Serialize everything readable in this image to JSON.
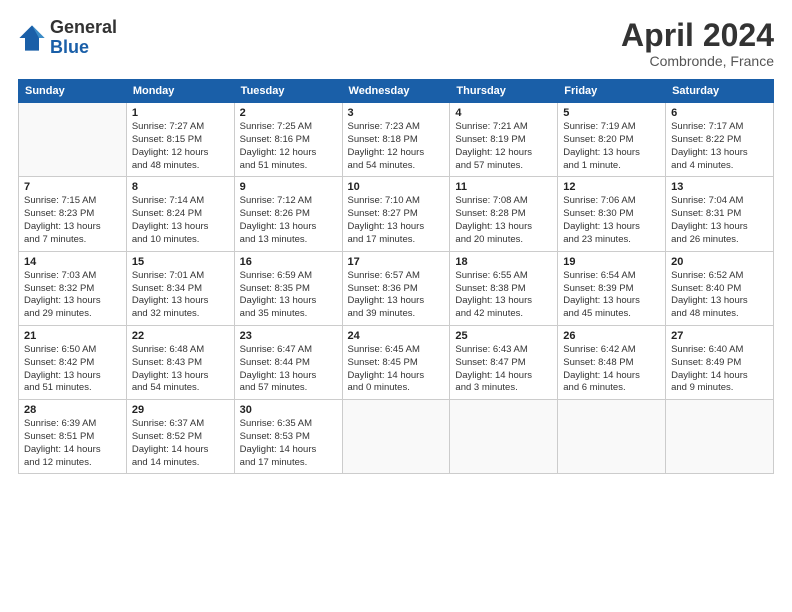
{
  "logo": {
    "general": "General",
    "blue": "Blue"
  },
  "title": "April 2024",
  "location": "Combronde, France",
  "days_header": [
    "Sunday",
    "Monday",
    "Tuesday",
    "Wednesday",
    "Thursday",
    "Friday",
    "Saturday"
  ],
  "weeks": [
    [
      {
        "num": "",
        "info": ""
      },
      {
        "num": "1",
        "info": "Sunrise: 7:27 AM\nSunset: 8:15 PM\nDaylight: 12 hours\nand 48 minutes."
      },
      {
        "num": "2",
        "info": "Sunrise: 7:25 AM\nSunset: 8:16 PM\nDaylight: 12 hours\nand 51 minutes."
      },
      {
        "num": "3",
        "info": "Sunrise: 7:23 AM\nSunset: 8:18 PM\nDaylight: 12 hours\nand 54 minutes."
      },
      {
        "num": "4",
        "info": "Sunrise: 7:21 AM\nSunset: 8:19 PM\nDaylight: 12 hours\nand 57 minutes."
      },
      {
        "num": "5",
        "info": "Sunrise: 7:19 AM\nSunset: 8:20 PM\nDaylight: 13 hours\nand 1 minute."
      },
      {
        "num": "6",
        "info": "Sunrise: 7:17 AM\nSunset: 8:22 PM\nDaylight: 13 hours\nand 4 minutes."
      }
    ],
    [
      {
        "num": "7",
        "info": "Sunrise: 7:15 AM\nSunset: 8:23 PM\nDaylight: 13 hours\nand 7 minutes."
      },
      {
        "num": "8",
        "info": "Sunrise: 7:14 AM\nSunset: 8:24 PM\nDaylight: 13 hours\nand 10 minutes."
      },
      {
        "num": "9",
        "info": "Sunrise: 7:12 AM\nSunset: 8:26 PM\nDaylight: 13 hours\nand 13 minutes."
      },
      {
        "num": "10",
        "info": "Sunrise: 7:10 AM\nSunset: 8:27 PM\nDaylight: 13 hours\nand 17 minutes."
      },
      {
        "num": "11",
        "info": "Sunrise: 7:08 AM\nSunset: 8:28 PM\nDaylight: 13 hours\nand 20 minutes."
      },
      {
        "num": "12",
        "info": "Sunrise: 7:06 AM\nSunset: 8:30 PM\nDaylight: 13 hours\nand 23 minutes."
      },
      {
        "num": "13",
        "info": "Sunrise: 7:04 AM\nSunset: 8:31 PM\nDaylight: 13 hours\nand 26 minutes."
      }
    ],
    [
      {
        "num": "14",
        "info": "Sunrise: 7:03 AM\nSunset: 8:32 PM\nDaylight: 13 hours\nand 29 minutes."
      },
      {
        "num": "15",
        "info": "Sunrise: 7:01 AM\nSunset: 8:34 PM\nDaylight: 13 hours\nand 32 minutes."
      },
      {
        "num": "16",
        "info": "Sunrise: 6:59 AM\nSunset: 8:35 PM\nDaylight: 13 hours\nand 35 minutes."
      },
      {
        "num": "17",
        "info": "Sunrise: 6:57 AM\nSunset: 8:36 PM\nDaylight: 13 hours\nand 39 minutes."
      },
      {
        "num": "18",
        "info": "Sunrise: 6:55 AM\nSunset: 8:38 PM\nDaylight: 13 hours\nand 42 minutes."
      },
      {
        "num": "19",
        "info": "Sunrise: 6:54 AM\nSunset: 8:39 PM\nDaylight: 13 hours\nand 45 minutes."
      },
      {
        "num": "20",
        "info": "Sunrise: 6:52 AM\nSunset: 8:40 PM\nDaylight: 13 hours\nand 48 minutes."
      }
    ],
    [
      {
        "num": "21",
        "info": "Sunrise: 6:50 AM\nSunset: 8:42 PM\nDaylight: 13 hours\nand 51 minutes."
      },
      {
        "num": "22",
        "info": "Sunrise: 6:48 AM\nSunset: 8:43 PM\nDaylight: 13 hours\nand 54 minutes."
      },
      {
        "num": "23",
        "info": "Sunrise: 6:47 AM\nSunset: 8:44 PM\nDaylight: 13 hours\nand 57 minutes."
      },
      {
        "num": "24",
        "info": "Sunrise: 6:45 AM\nSunset: 8:45 PM\nDaylight: 14 hours\nand 0 minutes."
      },
      {
        "num": "25",
        "info": "Sunrise: 6:43 AM\nSunset: 8:47 PM\nDaylight: 14 hours\nand 3 minutes."
      },
      {
        "num": "26",
        "info": "Sunrise: 6:42 AM\nSunset: 8:48 PM\nDaylight: 14 hours\nand 6 minutes."
      },
      {
        "num": "27",
        "info": "Sunrise: 6:40 AM\nSunset: 8:49 PM\nDaylight: 14 hours\nand 9 minutes."
      }
    ],
    [
      {
        "num": "28",
        "info": "Sunrise: 6:39 AM\nSunset: 8:51 PM\nDaylight: 14 hours\nand 12 minutes."
      },
      {
        "num": "29",
        "info": "Sunrise: 6:37 AM\nSunset: 8:52 PM\nDaylight: 14 hours\nand 14 minutes."
      },
      {
        "num": "30",
        "info": "Sunrise: 6:35 AM\nSunset: 8:53 PM\nDaylight: 14 hours\nand 17 minutes."
      },
      {
        "num": "",
        "info": ""
      },
      {
        "num": "",
        "info": ""
      },
      {
        "num": "",
        "info": ""
      },
      {
        "num": "",
        "info": ""
      }
    ]
  ]
}
